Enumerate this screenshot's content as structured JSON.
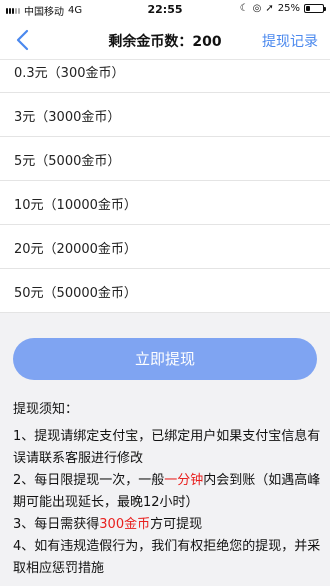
{
  "status_bar": {
    "carrier": "中国移动",
    "network": "4G",
    "time": "22:55",
    "battery_text": "25%",
    "battery_level": 0.25
  },
  "nav": {
    "title": "剩余金币数：200",
    "right_link": "提现记录",
    "back_icon": "chevron-left-icon"
  },
  "options": [
    {
      "label": "0.3元（300金币）"
    },
    {
      "label": "3元（3000金币）"
    },
    {
      "label": "5元（5000金币）"
    },
    {
      "label": "10元（10000金币）"
    },
    {
      "label": "20元（20000金币）"
    },
    {
      "label": "50元（50000金币）"
    }
  ],
  "withdraw_button": "立即提现",
  "notice": {
    "title": "提现须知：",
    "item1": "1、提现请绑定支付宝，已绑定用户如果支付宝信息有误请联系客服进行修改",
    "item2_pre": "2、每日限提现一次，一般",
    "item2_highlight": "一分钟",
    "item2_post": "内会到账（如遇高峰期可能出现延长，最晚12小时）",
    "item3_pre": "3、每日需获得",
    "item3_highlight": "300金币",
    "item3_post": "方可提现",
    "item4": "4、如有违规造假行为，我们有权拒绝您的提现，并采取相应惩罚措施"
  },
  "colors": {
    "accent": "#4a88ee",
    "button": "#7fa4f2",
    "highlight": "#e8201e"
  }
}
